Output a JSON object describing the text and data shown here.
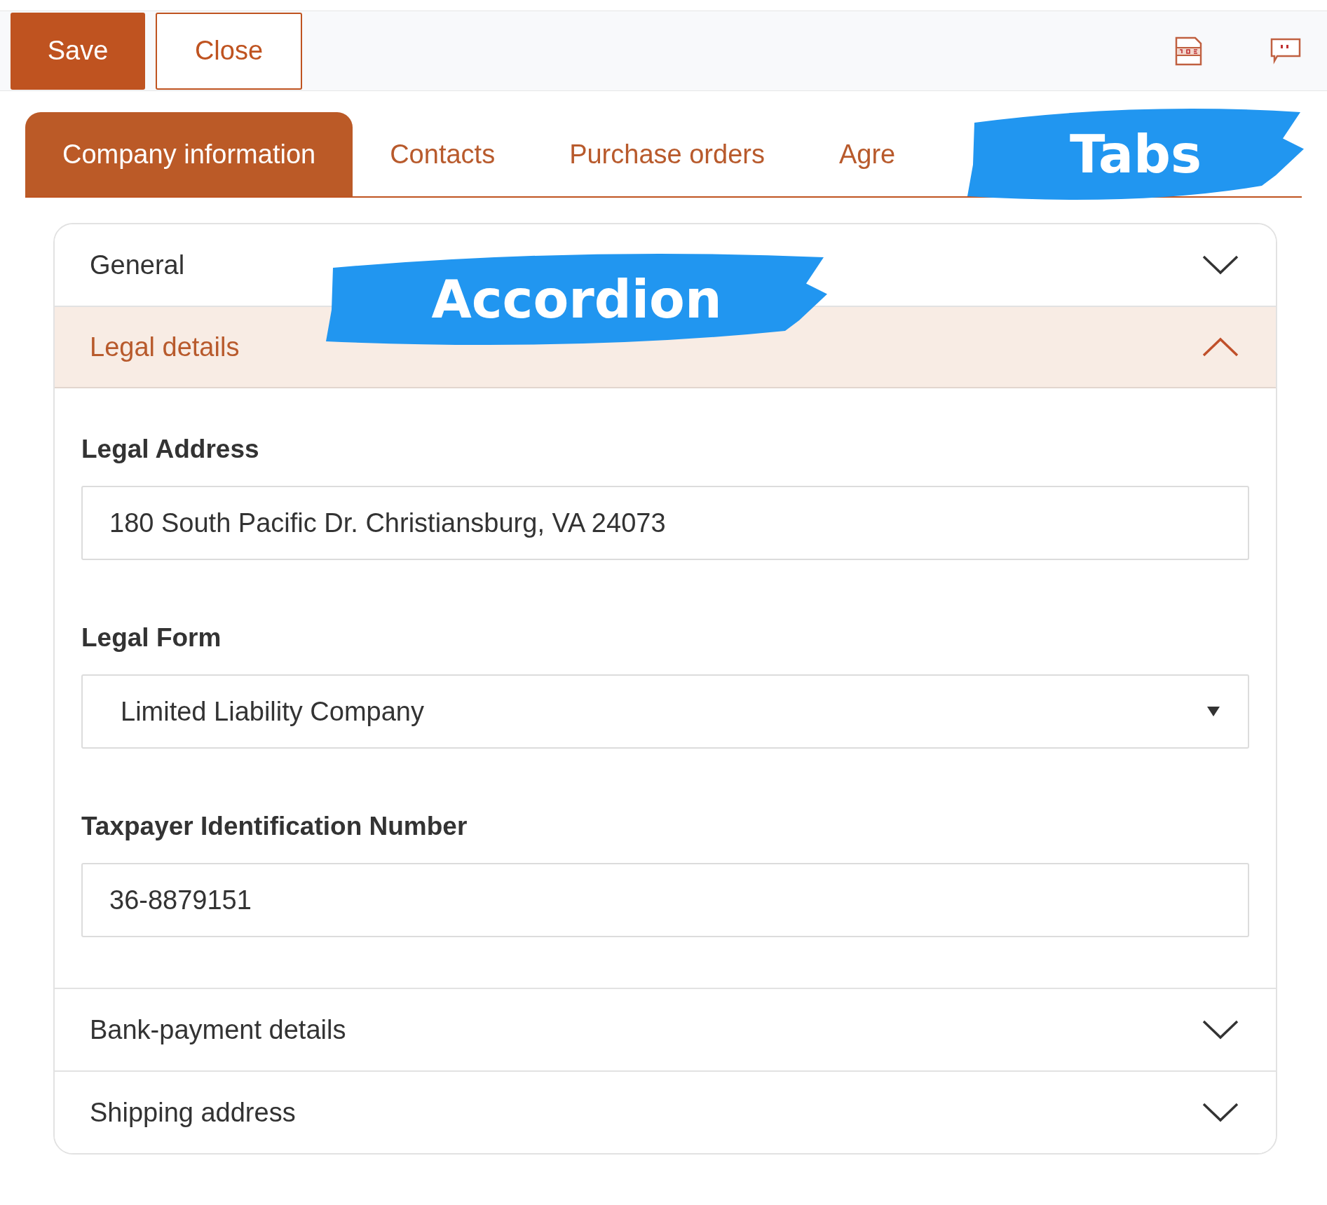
{
  "toolbar": {
    "buttons": [
      {
        "label": "Save",
        "kind": "primary"
      },
      {
        "label": "Close",
        "kind": "secondary"
      }
    ]
  },
  "tabs": [
    {
      "label": "Company information",
      "selected": true
    },
    {
      "label": "Contacts",
      "selected": false
    },
    {
      "label": "Purchase orders",
      "selected": false
    },
    {
      "label": "Agre",
      "selected": false
    }
  ],
  "accordion": [
    {
      "title": "General",
      "expanded": false
    },
    {
      "title": "Legal details",
      "expanded": true,
      "fields": [
        {
          "label": "Legal Address",
          "kind": "text",
          "value": "180 South Pacific Dr. Christiansburg, VA 24073"
        },
        {
          "label": "Legal Form",
          "kind": "select",
          "value": "Limited Liability Company"
        },
        {
          "label": "Taxpayer Identification Number",
          "kind": "text",
          "value": "36-8879151"
        }
      ]
    },
    {
      "title": "Bank-payment details",
      "expanded": false
    },
    {
      "title": "Shipping address",
      "expanded": false
    }
  ],
  "annotations": [
    {
      "label": "Tabs"
    },
    {
      "label": "Accordion"
    }
  ]
}
